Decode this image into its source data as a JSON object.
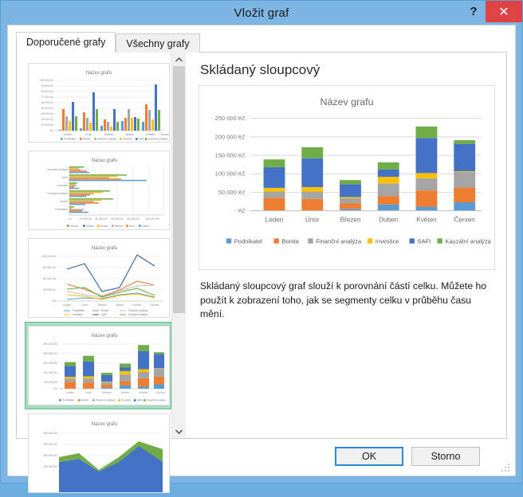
{
  "window": {
    "title": "Vložit graf",
    "help_label": "?",
    "close_label": "✕"
  },
  "tabs": [
    {
      "label": "Doporučené grafy",
      "active": true
    },
    {
      "label": "Všechny grafy",
      "active": false
    }
  ],
  "thumbnails": [
    {
      "name": "clustered-column",
      "selected": false,
      "title": "Název grafu"
    },
    {
      "name": "clustered-bar",
      "selected": false,
      "title": "Název grafu"
    },
    {
      "name": "line",
      "selected": false,
      "title": "Název grafu"
    },
    {
      "name": "stacked-column",
      "selected": true,
      "title": "Název grafu"
    },
    {
      "name": "stacked-area",
      "selected": false,
      "title": "Název grafu"
    }
  ],
  "scrollbar": {
    "up_arrow": "⌃",
    "down_arrow": "⌄"
  },
  "preview": {
    "heading": "Skládaný sloupcový",
    "description": "Skládaný sloupcový graf slouží k porovnání částí celku. Můžete ho použít k zobrazení toho, jak se segmenty celku v průběhu času mění."
  },
  "footer": {
    "ok_label": "OK",
    "cancel_label": "Storno"
  },
  "colors": {
    "titlebar": "#7cb4e4",
    "close": "#e04343",
    "selection": "#a8dcc0",
    "accent": "#2a8ad4",
    "series_podnikatel": "#5b9bd5",
    "series_bonita": "#ed7d31",
    "series_financni": "#a5a5a5",
    "series_investice": "#ffc000",
    "series_safi": "#4472c4",
    "series_kauzalni": "#70ad47"
  },
  "chart_data": {
    "type": "bar",
    "stacked": true,
    "title": "Název grafu",
    "xlabel": "",
    "ylabel": "",
    "categories": [
      "Leden",
      "Únor",
      "Březen",
      "Duben",
      "Květen",
      "Červen"
    ],
    "ylim": [
      0,
      262000
    ],
    "yticks": [
      0,
      50000,
      100000,
      150000,
      200000,
      250000
    ],
    "ytick_labels": [
      "-   Kč",
      "50 000 Kč",
      "100 000 Kč",
      "150 000 Kč",
      "200 000 Kč",
      "250 000 Kč"
    ],
    "grid": true,
    "legend_position": "bottom",
    "series": [
      {
        "name": "Podnikatel",
        "color": "#5b9bd5",
        "values": [
          0,
          0,
          5000,
          17000,
          11000,
          23000
        ]
      },
      {
        "name": "Bonita",
        "color": "#ed7d31",
        "values": [
          35000,
          32000,
          16000,
          23000,
          44000,
          40000
        ]
      },
      {
        "name": "Finanční analýza",
        "color": "#a5a5a5",
        "values": [
          17000,
          20000,
          13000,
          34000,
          33000,
          42000
        ]
      },
      {
        "name": "Investice",
        "color": "#ffc000",
        "values": [
          10000,
          12000,
          3000,
          18000,
          14000,
          2000
        ]
      },
      {
        "name": "SAFI",
        "color": "#4472c4",
        "values": [
          56000,
          78000,
          35000,
          20000,
          95000,
          74000
        ]
      },
      {
        "name": "Kauzální analýza",
        "color": "#70ad47",
        "values": [
          21000,
          30000,
          11000,
          19000,
          31000,
          10000
        ]
      }
    ],
    "totals": [
      139000,
      172000,
      83000,
      131000,
      228000,
      191000
    ]
  }
}
